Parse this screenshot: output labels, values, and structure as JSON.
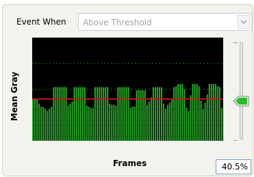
{
  "event": {
    "label": "Event When",
    "selected": "Above Threshold"
  },
  "chart_data": {
    "type": "bar",
    "xlabel": "Frames",
    "ylabel": "Mean Gray",
    "ylim": [
      0,
      100
    ],
    "threshold": 40.5,
    "bar_color": "#27a827",
    "threshold_color": "#c01717",
    "values": [
      41,
      41,
      40,
      36,
      33,
      33,
      31,
      29,
      31,
      33,
      52,
      52,
      52,
      52,
      52,
      52,
      52,
      34,
      36,
      38,
      52,
      52,
      52,
      52,
      52,
      52,
      34,
      33,
      32,
      32,
      52,
      52,
      52,
      52,
      52,
      52,
      52,
      36,
      35,
      35,
      34,
      52,
      52,
      52,
      52,
      52,
      52,
      32,
      33,
      33,
      49,
      49,
      49,
      49,
      49,
      35,
      38,
      42,
      52,
      52,
      52,
      52,
      52,
      36,
      31,
      35,
      37,
      41,
      52,
      53,
      55,
      55,
      55,
      50,
      32,
      29,
      44,
      55,
      55,
      55,
      53,
      39,
      31,
      37,
      45,
      55,
      55,
      55,
      55,
      53,
      52,
      32
    ]
  },
  "slider": {
    "value_percent": 40.5,
    "display": "40.5%"
  }
}
